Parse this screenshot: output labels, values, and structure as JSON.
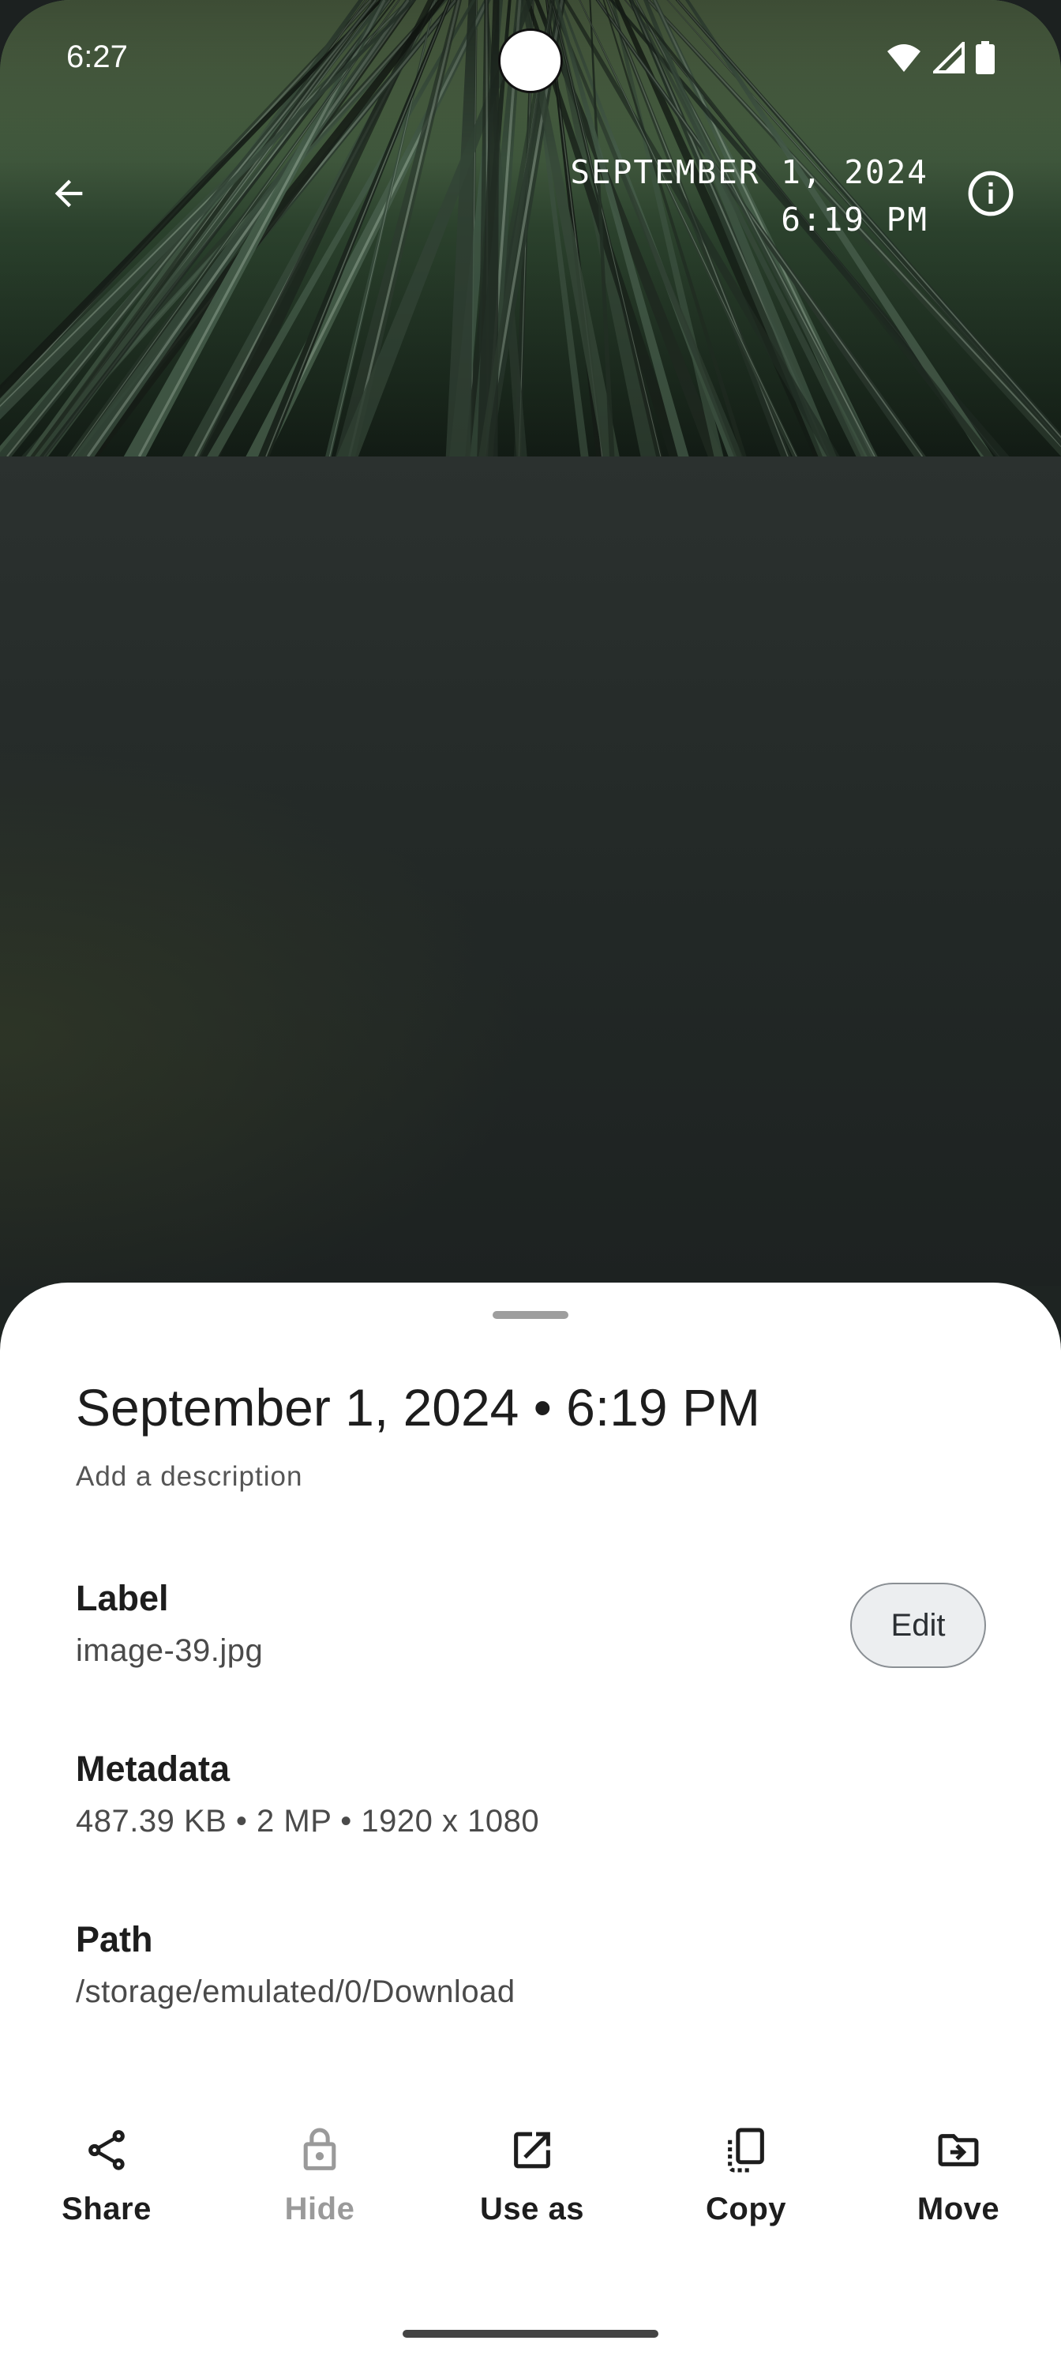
{
  "status_bar": {
    "time": "6:27",
    "icons": [
      "wifi-icon",
      "cell-signal-icon",
      "battery-icon"
    ]
  },
  "viewer": {
    "date_line1": "SEPTEMBER 1, 2024",
    "date_line2": "6:19 PM",
    "back_icon": "arrow-back-icon",
    "info_icon": "info-icon"
  },
  "sheet": {
    "title": "September 1, 2024 • 6:19 PM",
    "description_placeholder": "Add a description",
    "fields": {
      "label": {
        "title": "Label",
        "value": "image-39.jpg",
        "edit_label": "Edit"
      },
      "metadata": {
        "title": "Metadata",
        "value": "487.39 KB • 2 MP • 1920 x 1080"
      },
      "path": {
        "title": "Path",
        "value": "/storage/emulated/0/Download"
      }
    },
    "actions": [
      {
        "label": "Share",
        "icon": "share-icon",
        "enabled": true
      },
      {
        "label": "Hide",
        "icon": "lock-icon",
        "enabled": false
      },
      {
        "label": "Use as",
        "icon": "open-external-icon",
        "enabled": true
      },
      {
        "label": "Copy",
        "icon": "copy-icon",
        "enabled": true
      },
      {
        "label": "Move",
        "icon": "move-folder-icon",
        "enabled": true
      }
    ]
  },
  "colors": {
    "sheet_bg": "#ffffff",
    "text_primary": "#1d1d1d",
    "text_secondary": "#4a4a4a",
    "disabled": "#9a9a9a"
  }
}
